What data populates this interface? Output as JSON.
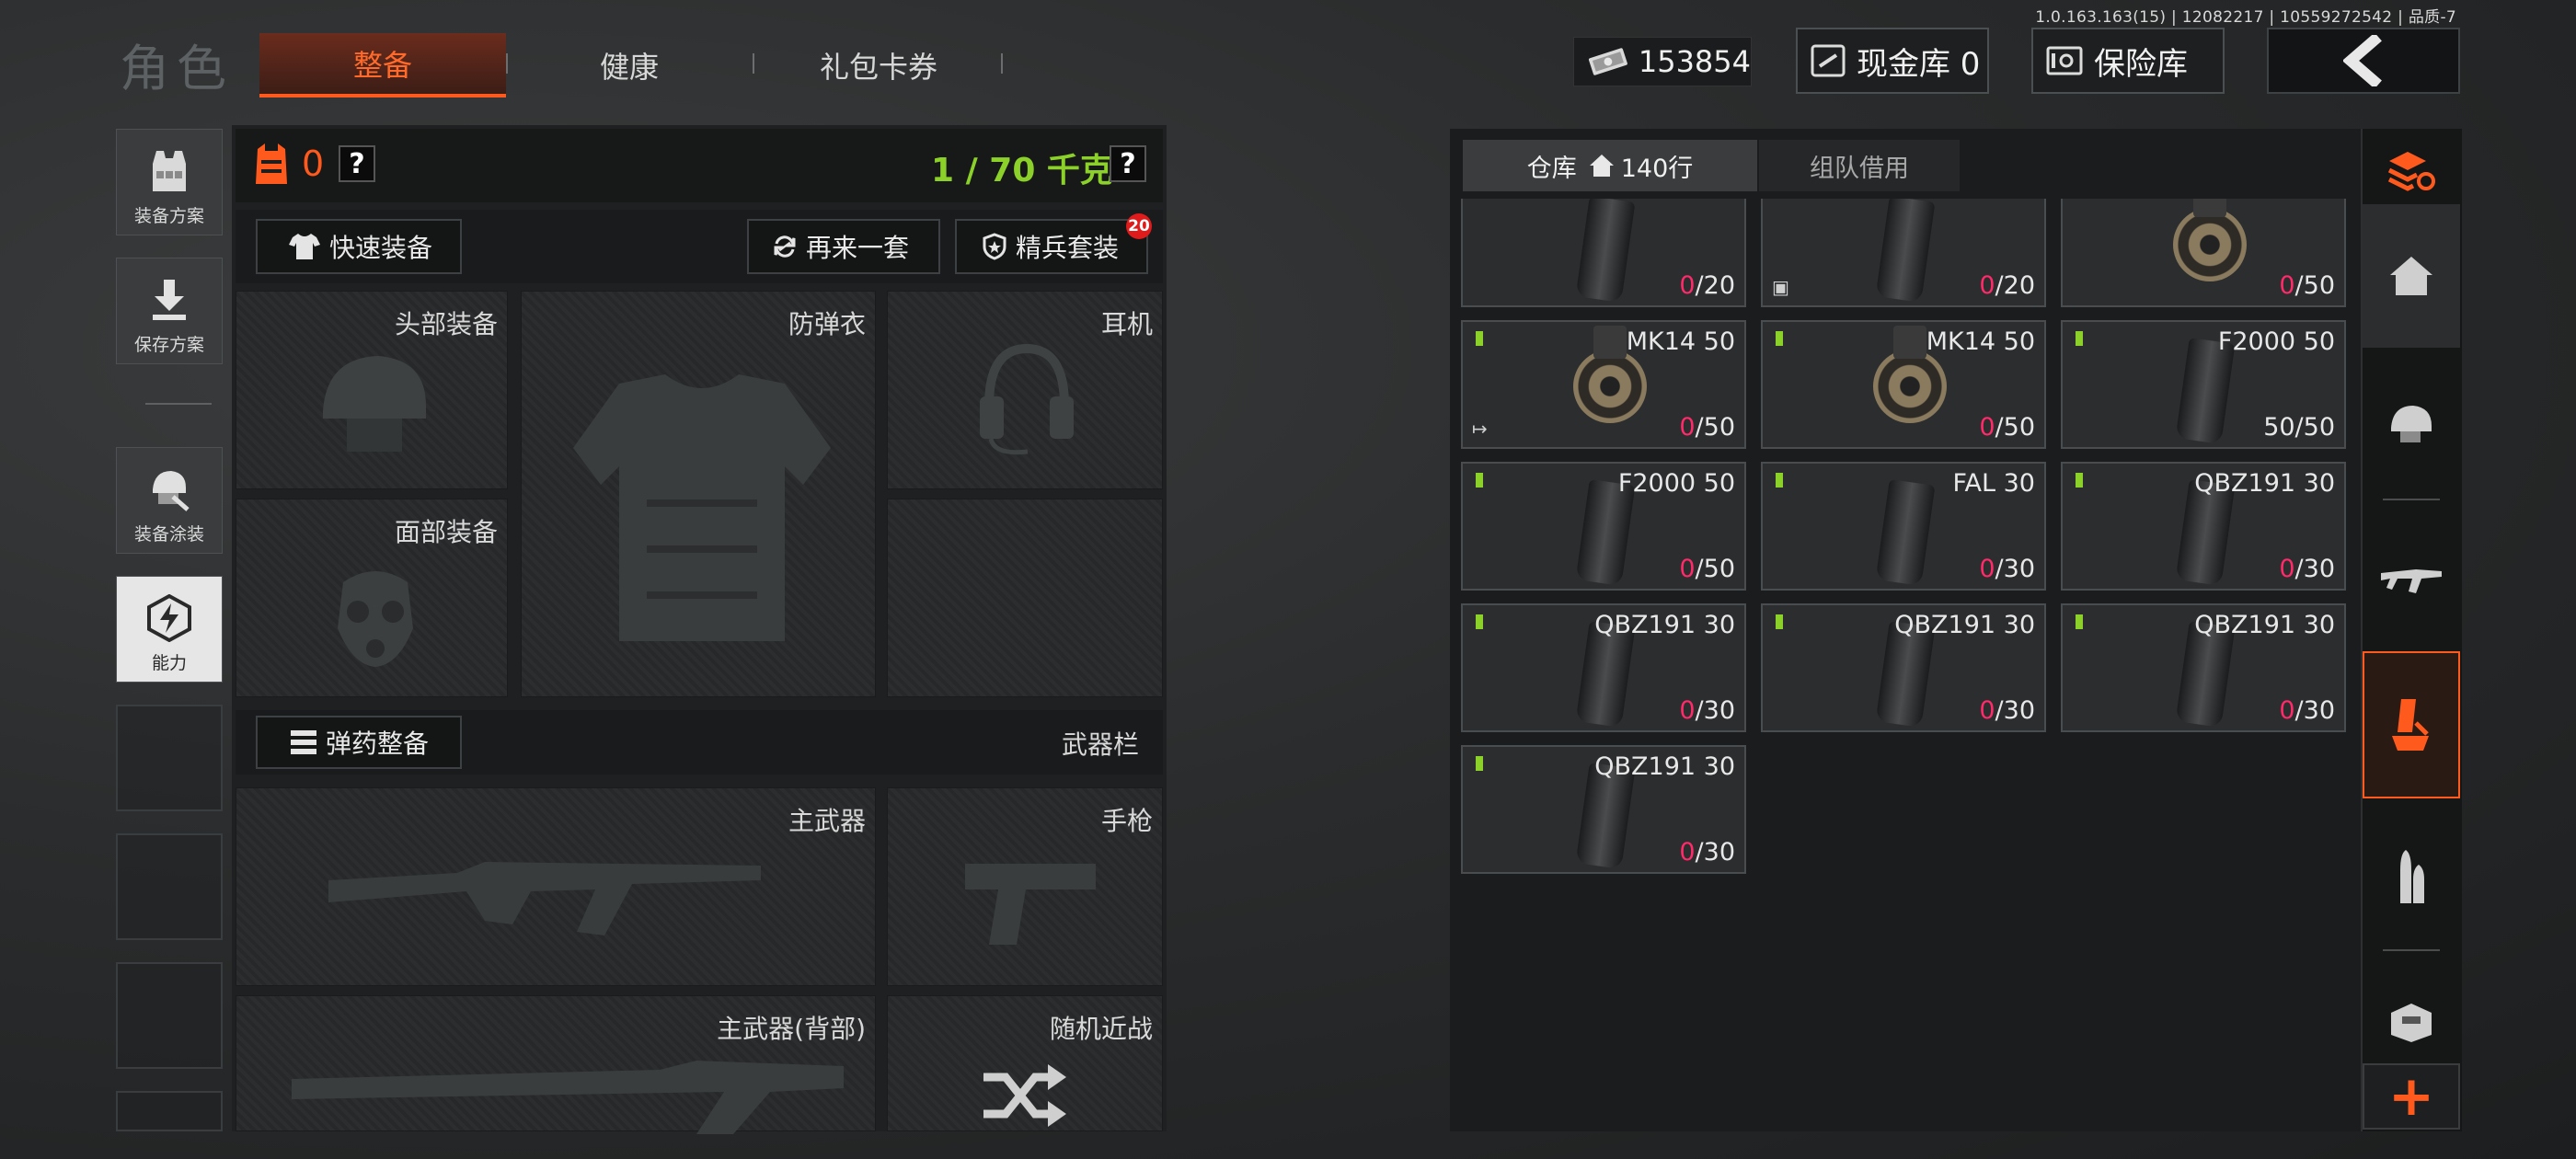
{
  "version_info": "1.0.163.163(15) | 12082217 | 10559272542 | 品质-7",
  "header": {
    "title": "角色",
    "tabs": [
      {
        "label": "整备",
        "active": true
      },
      {
        "label": "健康",
        "active": false
      },
      {
        "label": "礼包卡券",
        "active": false
      }
    ],
    "money": "153854",
    "cash_vault": "现金库 0",
    "safe_vault": "保险库"
  },
  "sidebar": {
    "items": [
      {
        "label": "装备方案",
        "icon": "vest-icon"
      },
      {
        "label": "保存方案",
        "icon": "download-icon"
      },
      {
        "label": "装备涂装",
        "icon": "helmet-paint-icon"
      },
      {
        "label": "能力",
        "icon": "ability-icon",
        "active": true
      }
    ]
  },
  "loadout": {
    "armor_count": "0",
    "help_label": "?",
    "weight": "1 / 70 千克",
    "quick_equip": "快速装备",
    "again_set": "再来一套",
    "elite_set": "精兵套装",
    "elite_badge": "20",
    "slots": {
      "head": "头部装备",
      "armor": "防弹衣",
      "earphone": "耳机",
      "face": "面部装备",
      "primary": "主武器",
      "pistol": "手枪",
      "primary_back": "主武器(背部)",
      "melee": "随机近战"
    },
    "ammo_equip": "弹药整备",
    "weapon_bar": "武器栏"
  },
  "warehouse": {
    "tab_storage": "仓库",
    "rows": "140行",
    "tab_team": "组队借用",
    "items": [
      {
        "name": "",
        "count_zero": "0",
        "count_max": "/20",
        "kind": "mag"
      },
      {
        "name": "",
        "count_zero": "0",
        "count_max": "/20",
        "kind": "mag"
      },
      {
        "name": "",
        "count_zero": "0",
        "count_max": "/50",
        "kind": "drum"
      },
      {
        "name": "MK14 50",
        "count_zero": "0",
        "count_max": "/50",
        "kind": "drum"
      },
      {
        "name": "MK14 50",
        "count_zero": "0",
        "count_max": "/50",
        "kind": "drum"
      },
      {
        "name": "F2000 50",
        "count_zero": "",
        "count_max": "50/50",
        "kind": "mag"
      },
      {
        "name": "F2000 50",
        "count_zero": "0",
        "count_max": "/50",
        "kind": "mag"
      },
      {
        "name": "FAL 30",
        "count_zero": "0",
        "count_max": "/30",
        "kind": "mag"
      },
      {
        "name": "QBZ191 30",
        "count_zero": "0",
        "count_max": "/30",
        "kind": "mag"
      },
      {
        "name": "QBZ191 30",
        "count_zero": "0",
        "count_max": "/30",
        "kind": "mag"
      },
      {
        "name": "QBZ191 30",
        "count_zero": "0",
        "count_max": "/30",
        "kind": "mag"
      },
      {
        "name": "QBZ191 30",
        "count_zero": "0",
        "count_max": "/30",
        "kind": "mag"
      },
      {
        "name": "QBZ191 30",
        "count_zero": "0",
        "count_max": "/30",
        "kind": "mag"
      }
    ]
  },
  "rail": {
    "icons": [
      "stack-refresh-icon",
      "home-icon",
      "helmet-icon",
      "rifle-icon",
      "ammo-box-icon",
      "bullet-icon",
      "armor-icon",
      "plus-icon"
    ],
    "plus": "+"
  },
  "colors": {
    "accent": "#ff5a1e",
    "green": "#8bd12a",
    "pink": "#ff2a6a"
  }
}
